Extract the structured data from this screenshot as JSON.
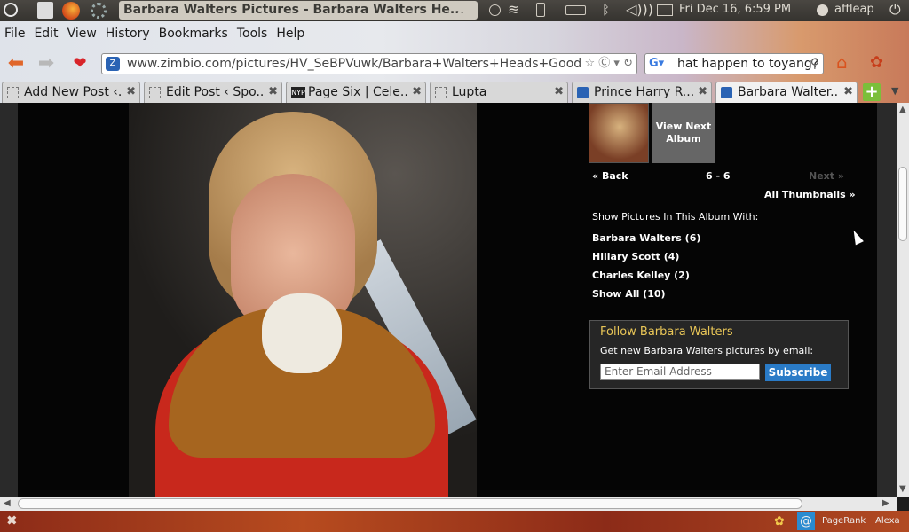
{
  "panel": {
    "window_title": "Barbara Walters Pictures - Barbara Walters He...",
    "datetime": "Fri Dec 16,  6:59 PM",
    "username": "affleap"
  },
  "menu": [
    {
      "label": "File"
    },
    {
      "label": "Edit"
    },
    {
      "label": "View"
    },
    {
      "label": "History"
    },
    {
      "label": "Bookmarks"
    },
    {
      "label": "Tools"
    },
    {
      "label": "Help"
    }
  ],
  "navbar": {
    "url": "www.zimbio.com/pictures/HV_SeBPVuwk/Barbara+Walters+Heads+Good+M",
    "search_value": "hat happen to toyang?"
  },
  "tabs": [
    {
      "label": "Add New Post ‹..."
    },
    {
      "label": "Edit Post ‹ Spo..."
    },
    {
      "label": "Page Six | Cele..."
    },
    {
      "label": "Lupta"
    },
    {
      "label": "Prince Harry R..."
    },
    {
      "label": "Barbara Walter..."
    }
  ],
  "album": {
    "next_album": "View Next Album",
    "back": "Back",
    "counter": "6 - 6",
    "next": "Next",
    "all_thumbnails": "All Thumbnails »",
    "filter_heading": "Show Pictures In This Album With:",
    "filters": [
      {
        "label": "Barbara Walters (6)"
      },
      {
        "label": "Hillary Scott (4)"
      },
      {
        "label": "Charles Kelley (2)"
      },
      {
        "label": "Show All (10)"
      }
    ]
  },
  "follow": {
    "title": "Follow Barbara Walters",
    "subtitle": "Get new Barbara Walters pictures by email:",
    "email_placeholder": "Enter Email Address",
    "subscribe": "Subscribe"
  },
  "statusbar": {
    "pagerank": "PageRank",
    "alexa": "Alexa"
  }
}
